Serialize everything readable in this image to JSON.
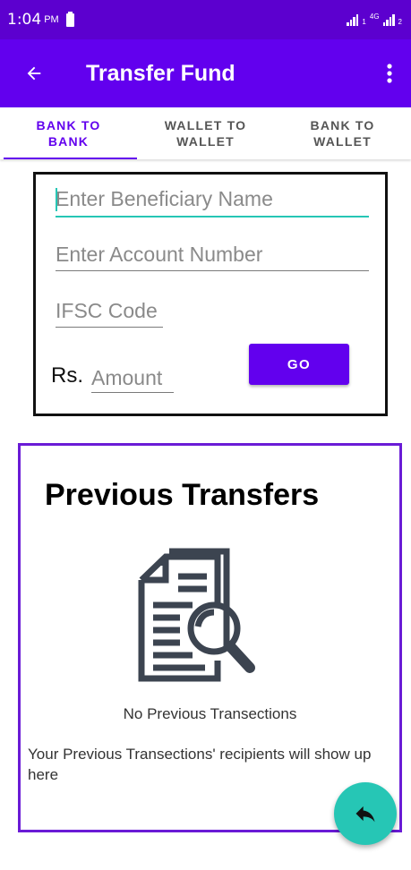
{
  "status_bar": {
    "time": "1:04",
    "ampm": "PM",
    "network_label": "4G",
    "sim1": "1",
    "sim2": "2"
  },
  "app_bar": {
    "title": "Transfer Fund",
    "back_icon": "arrow-left-icon",
    "menu_icon": "more-vert-icon"
  },
  "tabs": [
    {
      "label": "BANK TO\nBANK",
      "active": true
    },
    {
      "label": "WALLET TO\nWALLET",
      "active": false
    },
    {
      "label": "BANK TO\nWALLET",
      "active": false
    }
  ],
  "form": {
    "beneficiary_placeholder": "Enter Beneficiary Name",
    "account_placeholder": "Enter Account Number",
    "ifsc_placeholder": "IFSC Code",
    "currency_label": "Rs.",
    "amount_placeholder": "Amount",
    "go_label": "GO"
  },
  "previous": {
    "title": "Previous Transfers",
    "empty_title": "No Previous Transections",
    "empty_note": "Your Previous Transections' recipients will show up here",
    "icon": "document-search-icon"
  },
  "fab": {
    "icon": "reply-icon"
  },
  "colors": {
    "primary": "#6200ee",
    "status_bar": "#5c00cf",
    "accent": "#26c6b5"
  }
}
